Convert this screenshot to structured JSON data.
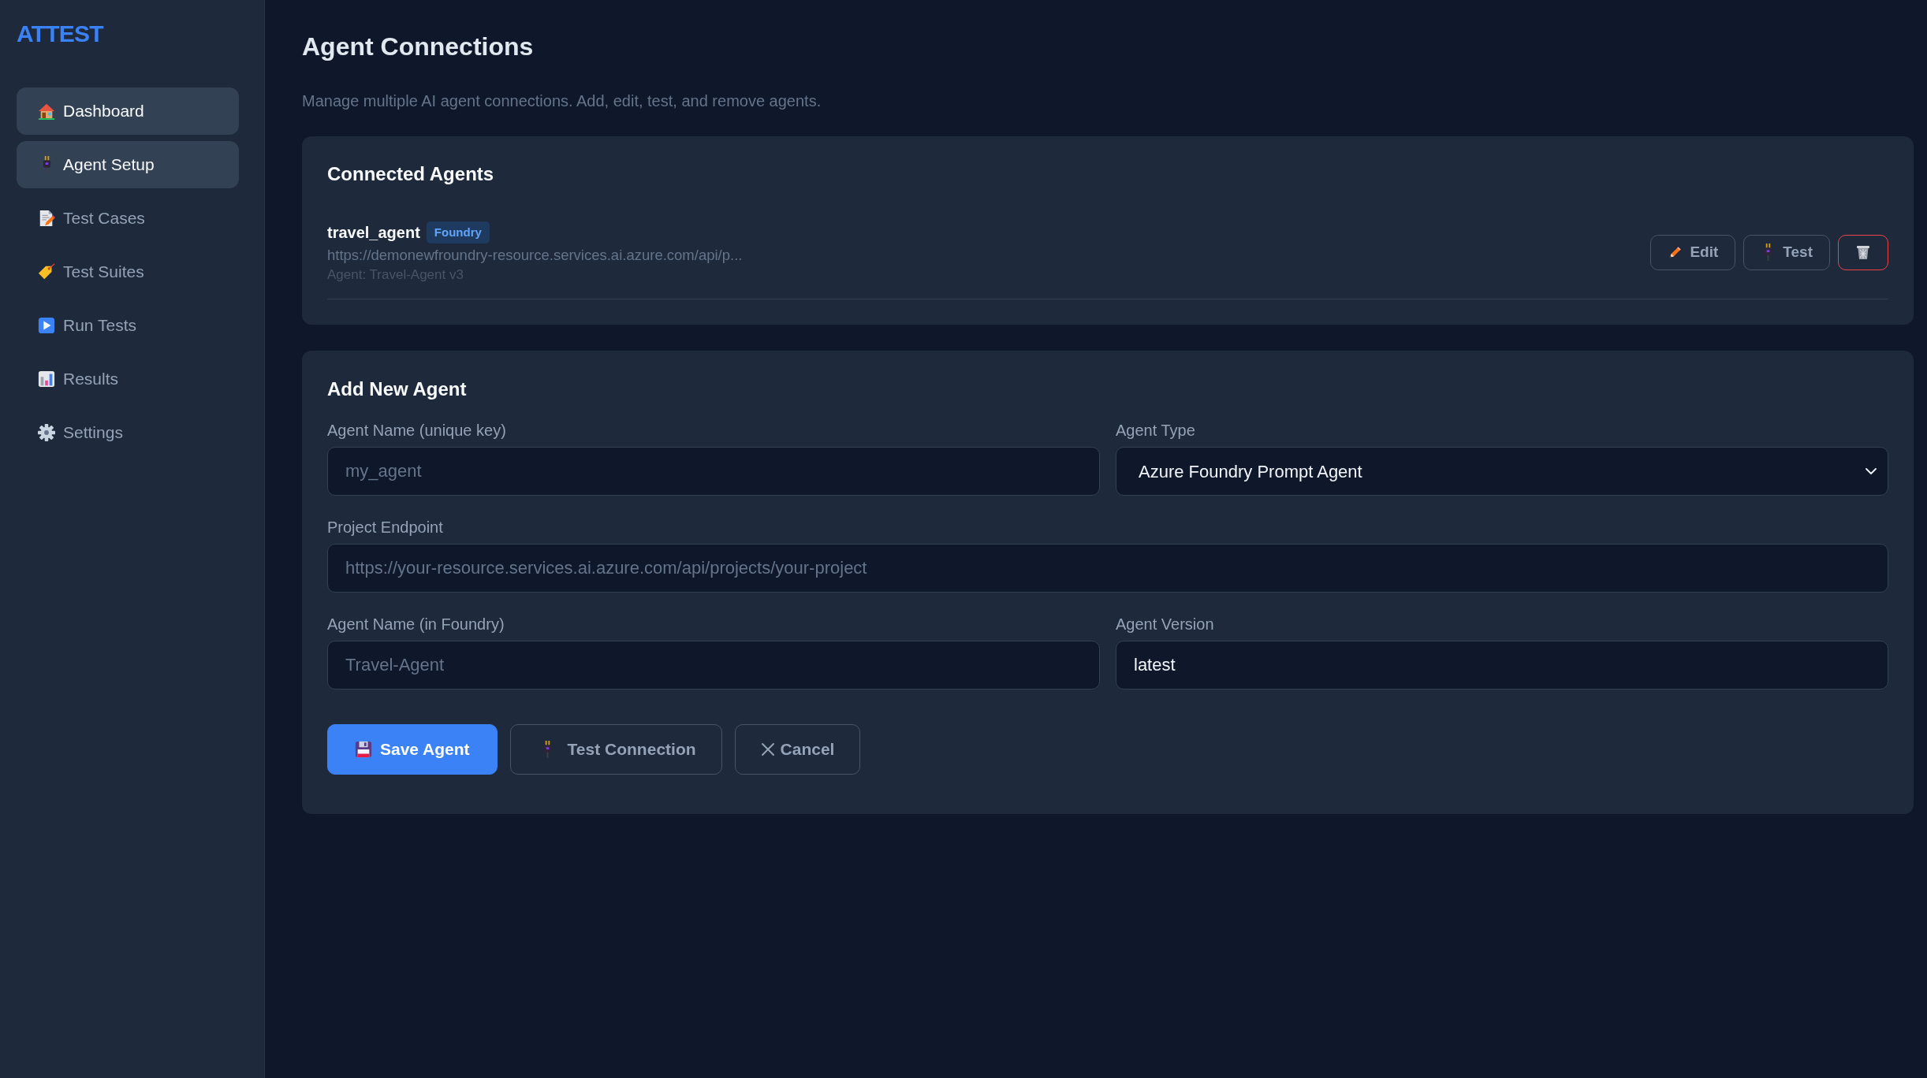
{
  "sidebar": {
    "logo": "ATTEST",
    "items": [
      {
        "label": "Dashboard",
        "selected": true
      },
      {
        "label": "Agent Setup",
        "selected": true
      },
      {
        "label": "Test Cases",
        "selected": false
      },
      {
        "label": "Test Suites",
        "selected": false
      },
      {
        "label": "Run Tests",
        "selected": false
      },
      {
        "label": "Results",
        "selected": false
      },
      {
        "label": "Settings",
        "selected": false
      }
    ]
  },
  "page": {
    "title": "Agent Connections",
    "subtitle": "Manage multiple AI agent connections. Add, edit, test, and remove agents."
  },
  "connected_agents": {
    "title": "Connected Agents",
    "agents": [
      {
        "name": "travel_agent",
        "badge": "Foundry",
        "endpoint": "https://demonewfroundry-resource.services.ai.azure.com/api/p...",
        "details": "Agent: Travel-Agent v3",
        "actions": [
          {
            "kind": "edit",
            "label": "Edit"
          },
          {
            "kind": "test",
            "label": "Test"
          },
          {
            "kind": "delete"
          }
        ]
      }
    ]
  },
  "add_agent": {
    "title": "Add New Agent",
    "rows": [
      [
        {
          "kind": "text",
          "label": "Agent Name (unique key)",
          "placeholder": "my_agent"
        },
        {
          "kind": "select",
          "label": "Agent Type",
          "value": "Azure Foundry Prompt Agent"
        }
      ],
      [
        {
          "kind": "text",
          "label": "Project Endpoint",
          "placeholder": "https://your-resource.services.ai.azure.com/api/projects/your-project"
        }
      ],
      [
        {
          "kind": "text",
          "label": "Agent Name (in Foundry)",
          "placeholder": "Travel-Agent"
        },
        {
          "kind": "text",
          "label": "Agent Version",
          "value": "latest"
        }
      ]
    ],
    "buttons": [
      {
        "kind": "save",
        "label": "Save Agent"
      },
      {
        "kind": "test",
        "label": "Test Connection"
      },
      {
        "kind": "cancel",
        "label": "Cancel"
      }
    ]
  }
}
